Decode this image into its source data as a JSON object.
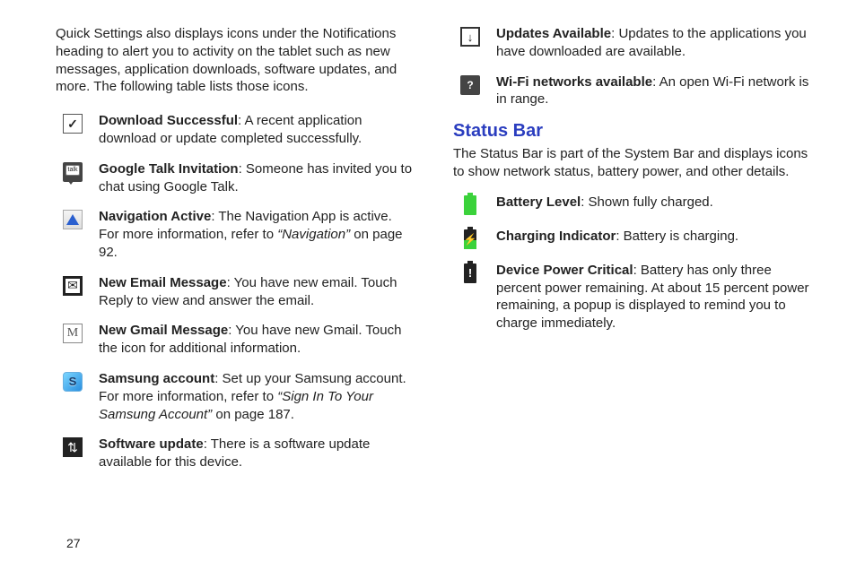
{
  "page_number": "27",
  "left": {
    "intro": "Quick Settings also displays icons under the Notifications heading to alert you to activity on the tablet such as new messages, application downloads, software updates, and more. The following table lists those icons.",
    "items": [
      {
        "icon": "download-ok",
        "term": "Download Successful",
        "text": ": A recent application download or update completed successfully."
      },
      {
        "icon": "talk",
        "term": "Google Talk Invitation",
        "text": ": Someone has invited you to chat using Google Talk."
      },
      {
        "icon": "nav",
        "term": "Navigation Active",
        "text": ": The Navigation App is active. For more information, refer to ",
        "ref": "“Navigation”",
        "tail": "  on page 92."
      },
      {
        "icon": "email",
        "term": "New Email Message",
        "text": ": You have new email. Touch Reply to view and answer the email."
      },
      {
        "icon": "gmail",
        "term": "New Gmail Message",
        "text": ": You have new Gmail. Touch the icon for additional information."
      },
      {
        "icon": "samsung",
        "term": "Samsung account",
        "text": ": Set up your Samsung account. For more information, refer to ",
        "ref": "“Sign In To Your Samsung Account”",
        "tail": "  on page 187."
      },
      {
        "icon": "swupdate",
        "term": "Software update",
        "text": ": There is a software update available for this device."
      }
    ]
  },
  "right": {
    "topItems": [
      {
        "icon": "updates",
        "term": "Updates Available",
        "text": ": Updates to the applications you have downloaded are available."
      },
      {
        "icon": "wifi",
        "term": "Wi-Fi networks available",
        "text": ": An open Wi-Fi network is in range."
      }
    ],
    "heading": "Status Bar",
    "headingText": "The Status Bar is part of the System Bar and displays icons to show network status, battery power, and other details.",
    "items": [
      {
        "icon": "batt-full",
        "term": "Battery Level",
        "text": ": Shown fully charged."
      },
      {
        "icon": "batt-charge",
        "term": "Charging Indicator",
        "text": ": Battery is charging."
      },
      {
        "icon": "batt-crit",
        "term": "Device Power Critical",
        "text": ": Battery has only three percent power remaining. At about 15 percent power remaining, a popup is displayed to remind you to charge immediately."
      }
    ]
  }
}
